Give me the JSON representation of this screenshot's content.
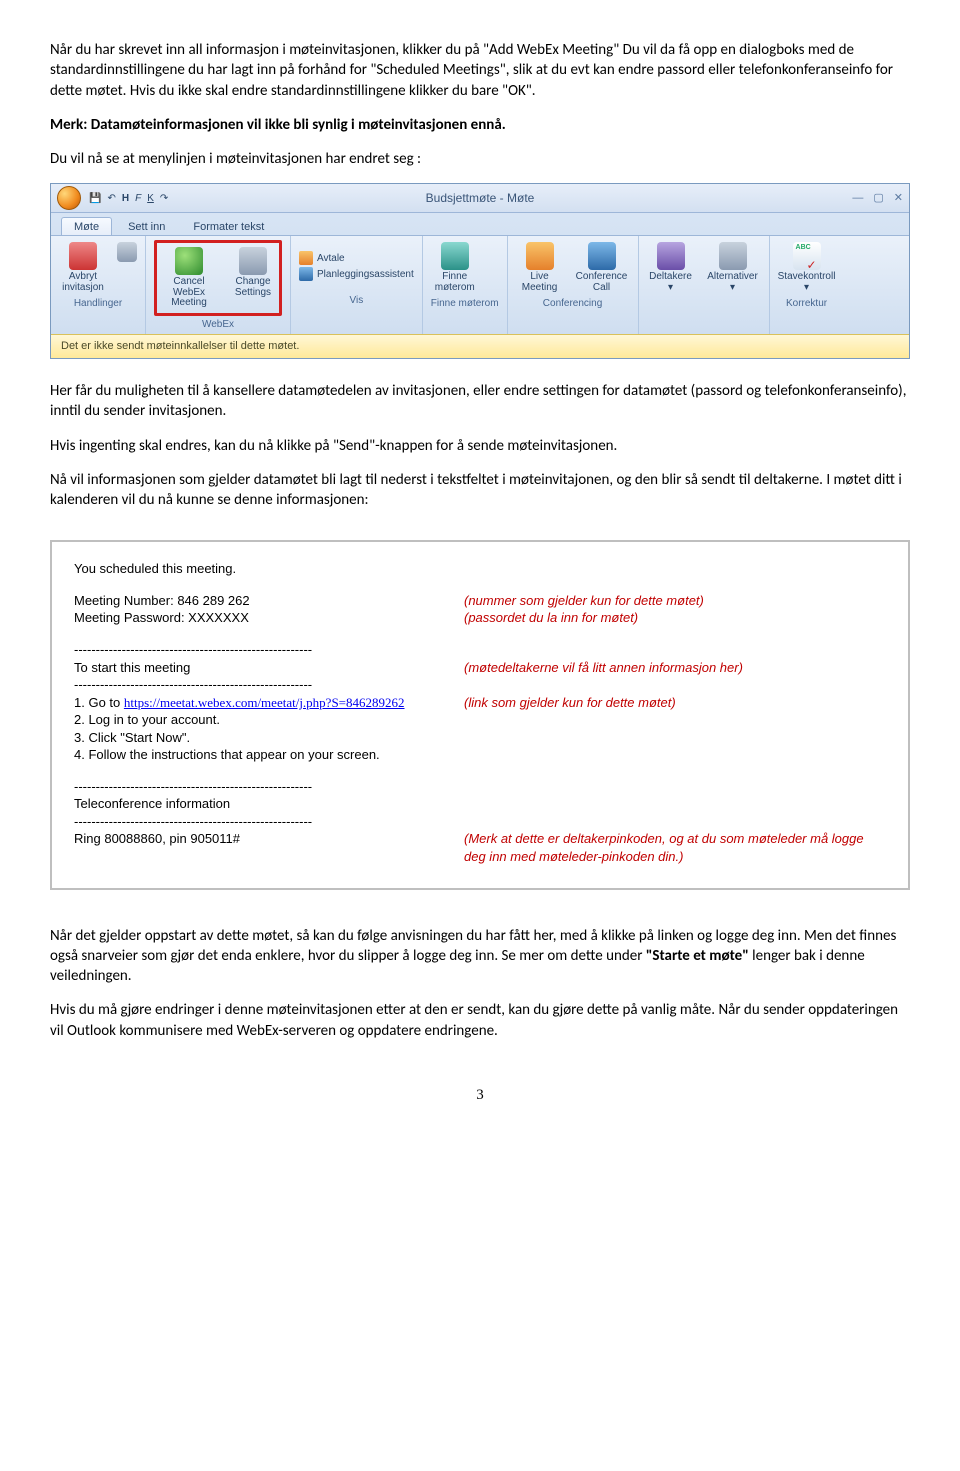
{
  "para1": "Når du har skrevet inn all informasjon i møteinvitasjonen, klikker du på \"Add WebEx Meeting\" Du vil da få opp en dialogboks med de standardinnstillingene du har lagt inn på forhånd for \"Scheduled Meetings\", slik at du evt kan endre passord eller telefonkonferanseinfo for dette møtet. Hvis du ikke skal endre standardinnstillingene klikker du bare \"OK\".",
  "para2": "Merk: Datamøteinformasjonen vil ikke bli synlig i møteinvitasjonen ennå.",
  "para3": "Du vil nå se at menylinjen i møteinvitasjonen har endret seg :",
  "para4": "Her får du muligheten til å kansellere datamøtedelen av invitasjonen, eller endre settingen for datamøtet (passord og telefonkonferanseinfo), inntil  du sender invitasjonen.",
  "para5": "Hvis ingenting skal endres, kan du nå klikke på \"Send\"-knappen for å sende møteinvitasjonen.",
  "para6": "Nå vil informasjonen som gjelder datamøtet bli lagt til nederst i tekstfeltet i møteinvitajonen, og den blir så sendt til deltakerne.  I møtet ditt i kalenderen vil du nå kunne se denne informasjonen:",
  "box": {
    "heading": "You scheduled this meeting.",
    "meeting_number_label": "Meeting Number: 846 289 262",
    "meeting_number_note": "(nummer som gjelder kun for dette møtet)",
    "meeting_pw_label": "Meeting Password: XXXXXXX",
    "meeting_pw_note": "(passordet du la inn for møtet)",
    "dashes": "-------------------------------------------------------",
    "start_label": "To start this meeting",
    "start_note": "(møtedeltakerne vil få litt annen informasjon her)",
    "step1_prefix": "1. Go to ",
    "step1_link": "https://meetat.webex.com/meetat/j.php?S=846289262",
    "step1_note": "(link som gjelder kun for dette møtet)",
    "step2": "2. Log in to your account.",
    "step3": "3. Click \"Start Now\".",
    "step4": "4. Follow the instructions that appear on your screen.",
    "tele_label": "Teleconference information",
    "ring_label": "Ring 80088860, pin 905011#",
    "ring_note": "(Merk at dette er deltakerpinkoden, og at du som møteleder må logge deg inn med møteleder-pinkoden din.)"
  },
  "para7": "Når det gjelder oppstart av dette møtet, så  kan du følge anvisningen du har fått her, med å klikke på linken og logge deg inn. Men det finnes også snarveier som gjør det enda enklere, hvor du slipper å logge deg inn. Se mer om dette under ",
  "para7_bold": "\"Starte et møte\"",
  "para7_end": " lenger bak i denne veiledningen.",
  "para8": "Hvis du må gjøre endringer i denne møteinvitasjonen etter at den er sendt, kan du gjøre dette på vanlig måte. Når du sender oppdateringen vil Outlook kommunisere med WebEx-serveren og oppdatere endringene.",
  "page_num": "3",
  "ribbon": {
    "qat": {
      "a": "H",
      "b": "F",
      "c": "K"
    },
    "title": "Budsjettmøte - Møte",
    "tabs": {
      "t1": "Møte",
      "t2": "Sett inn",
      "t3": "Formater tekst"
    },
    "btns": {
      "avbryt1": "Avbryt",
      "avbryt2": "invitasjon",
      "cancel1": "Cancel WebEx",
      "cancel2": "Meeting",
      "change1": "Change",
      "change2": "Settings",
      "avtale": "Avtale",
      "plan": "Planleggingsassistent",
      "finne1": "Finne",
      "finne2": "møterom",
      "live1": "Live",
      "live2": "Meeting",
      "conf1": "Conference",
      "conf2": "Call",
      "deltakere": "Deltakere",
      "alternativer": "Alternativer",
      "stave": "Stavekontroll"
    },
    "groups": {
      "g1": "Handlinger",
      "g2": "WebEx",
      "g3": "Vis",
      "g4": "Finne møterom",
      "g5": "Conferencing",
      "g6": "Korrektur"
    },
    "status": "Det er ikke sendt møteinnkallelser til dette møtet."
  }
}
